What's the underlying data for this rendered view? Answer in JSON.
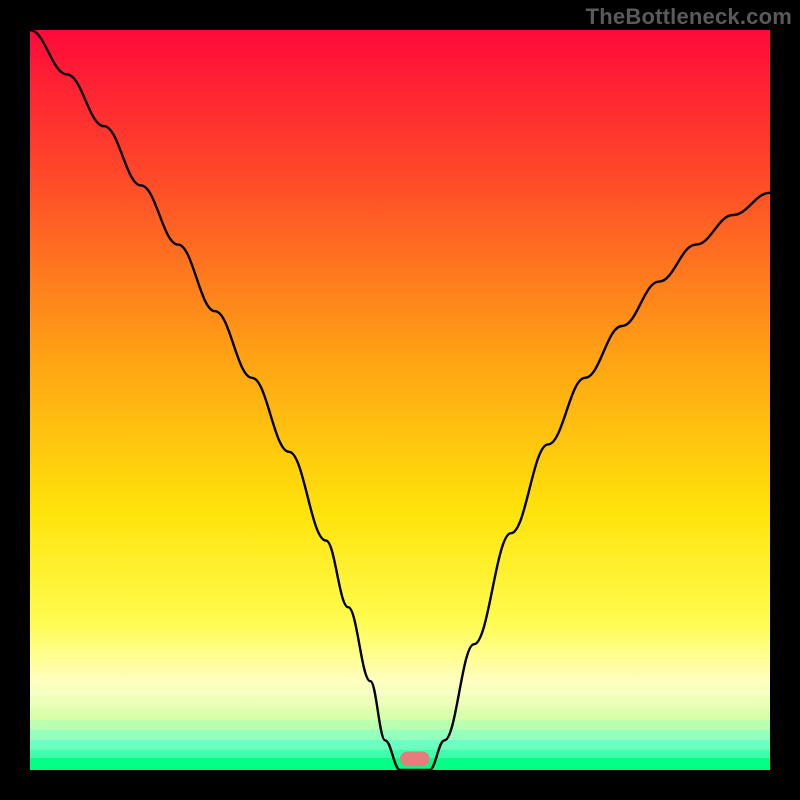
{
  "watermark": "TheBottleneck.com",
  "chart_data": {
    "type": "line",
    "title": "",
    "xlabel": "",
    "ylabel": "",
    "xlim": [
      0,
      100
    ],
    "ylim": [
      0,
      100
    ],
    "grid": false,
    "legend": false,
    "background": {
      "type": "vertical-gradient-with-bands",
      "stops": [
        {
          "pos": 0.0,
          "color": "#ff0a3a"
        },
        {
          "pos": 0.2,
          "color": "#ff4a29"
        },
        {
          "pos": 0.45,
          "color": "#ffa514"
        },
        {
          "pos": 0.65,
          "color": "#ffe30a"
        },
        {
          "pos": 0.8,
          "color": "#fffc50"
        },
        {
          "pos": 0.88,
          "color": "#ffffc0"
        },
        {
          "pos": 0.93,
          "color": "#d8ffa8"
        },
        {
          "pos": 0.965,
          "color": "#7dffc4"
        },
        {
          "pos": 1.0,
          "color": "#00ff85"
        }
      ]
    },
    "series": [
      {
        "name": "bottleneck-curve",
        "x": [
          0,
          5,
          10,
          15,
          20,
          25,
          30,
          35,
          40,
          43,
          46,
          48,
          50,
          52,
          54,
          56,
          60,
          65,
          70,
          75,
          80,
          85,
          90,
          95,
          100
        ],
        "y": [
          100,
          94,
          87,
          79,
          71,
          62,
          53,
          43,
          31,
          22,
          12,
          4,
          0,
          0,
          0,
          4,
          17,
          32,
          44,
          53,
          60,
          66,
          71,
          75,
          78
        ]
      }
    ],
    "marker": {
      "name": "sweet-spot",
      "shape": "capsule",
      "x_center": 52,
      "y_center": 1.5,
      "width": 4,
      "height": 2,
      "color": "#e77c7c"
    }
  }
}
